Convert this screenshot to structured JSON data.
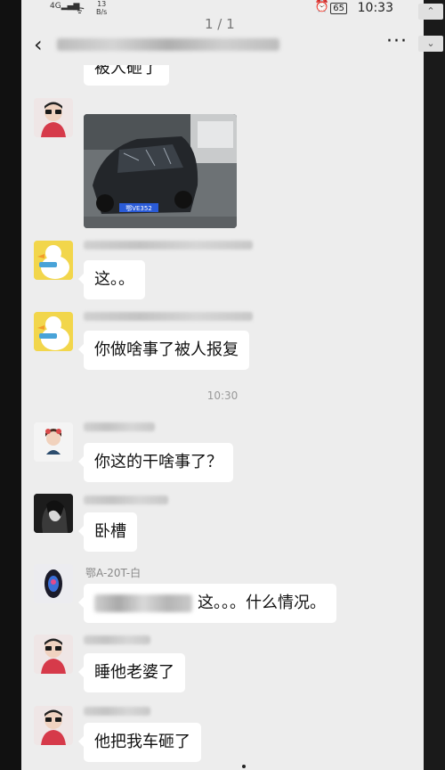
{
  "status_bar": {
    "network": "4G",
    "speed_value": "13",
    "speed_unit": "B/s",
    "battery": "65",
    "time": "10:33"
  },
  "header": {
    "page_indicator": "1 / 1",
    "more": "···"
  },
  "messages": [
    {
      "type": "text",
      "text": "被人砸了"
    },
    {
      "type": "image"
    },
    {
      "type": "text",
      "text": "这。。"
    },
    {
      "type": "text",
      "text": "你做啥事了被人报复"
    },
    {
      "type": "time",
      "text": "10:30"
    },
    {
      "type": "text",
      "text": "你这的干啥事了？"
    },
    {
      "type": "text",
      "text": "卧槽"
    },
    {
      "type": "text",
      "sender": "鄂A-20T-白",
      "text": "这。。。什么情况。"
    },
    {
      "type": "text",
      "text": "睡他老婆了"
    },
    {
      "type": "text",
      "text": "他把我车砸了"
    }
  ],
  "plate_text": "鄂VE352"
}
